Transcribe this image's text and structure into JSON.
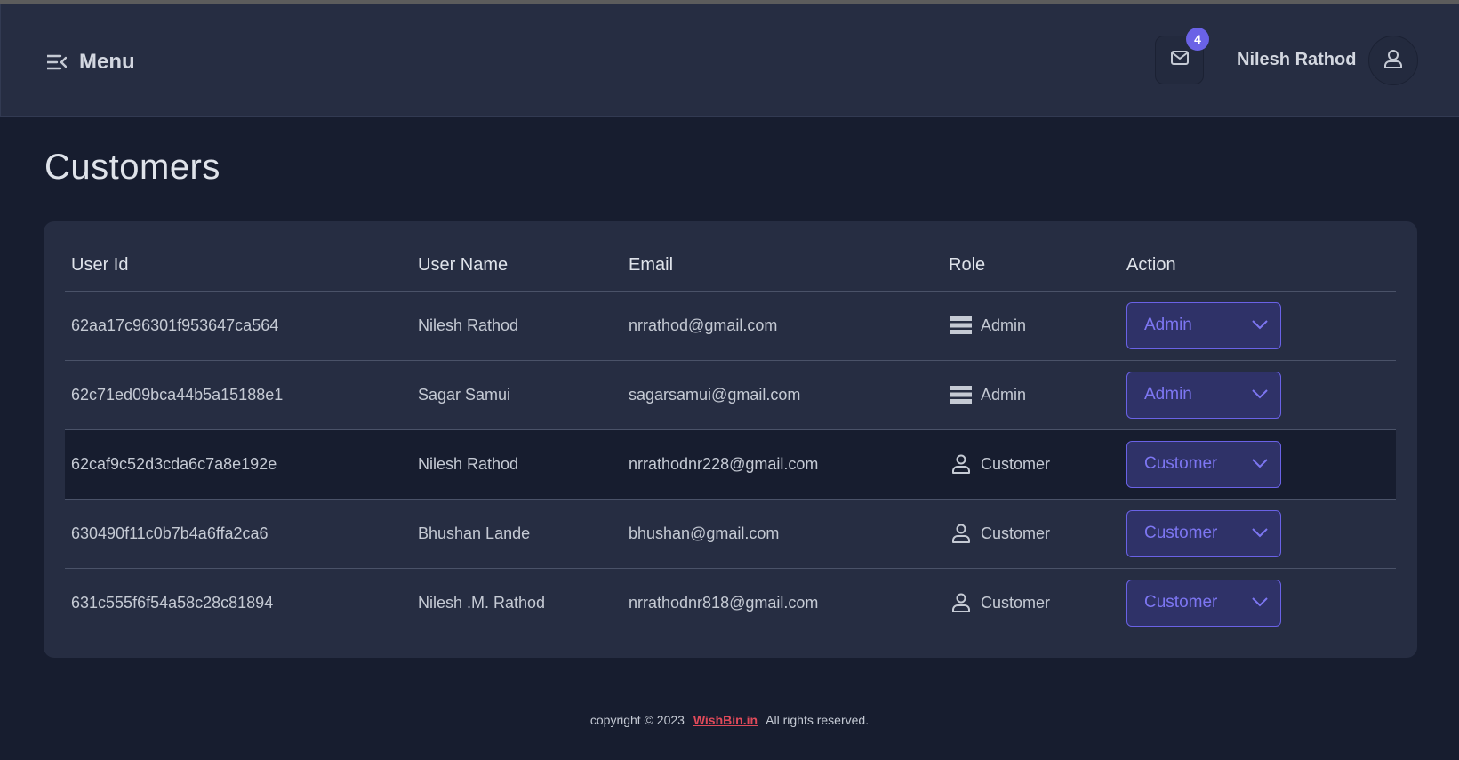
{
  "header": {
    "menu_label": "Menu",
    "notification_count": "4",
    "user_name": "Nilesh Rathod",
    "icons": {
      "menu": "menu-collapse-icon",
      "mail": "envelope-icon",
      "user": "user-icon"
    }
  },
  "page": {
    "title": "Customers"
  },
  "table": {
    "columns": [
      "User Id",
      "User Name",
      "Email",
      "Role",
      "Action"
    ],
    "rows": [
      {
        "id": "62aa17c96301f953647ca564",
        "name": "Nilesh Rathod",
        "email": "nrrathod@gmail.com",
        "role": "Admin",
        "role_icon": "server-icon",
        "action": "Admin"
      },
      {
        "id": "62c71ed09bca44b5a15188e1",
        "name": "Sagar Samui",
        "email": "sagarsamui@gmail.com",
        "role": "Admin",
        "role_icon": "server-icon",
        "action": "Admin"
      },
      {
        "id": "62caf9c52d3cda6c7a8e192e",
        "name": "Nilesh Rathod",
        "email": "nrrathodnr228@gmail.com",
        "role": "Customer",
        "role_icon": "user-icon",
        "action": "Customer"
      },
      {
        "id": "630490f11c0b7b4a6ffa2ca6",
        "name": "Bhushan Lande",
        "email": "bhushan@gmail.com",
        "role": "Customer",
        "role_icon": "user-icon",
        "action": "Customer"
      },
      {
        "id": "631c555f6f54a58c28c81894",
        "name": "Nilesh .M. Rathod",
        "email": "nrrathodnr818@gmail.com",
        "role": "Customer",
        "role_icon": "user-icon",
        "action": "Customer"
      }
    ]
  },
  "footer": {
    "prefix": "copyright © 2023",
    "link": "WishBin.in",
    "suffix": "All rights reserved."
  },
  "colors": {
    "background": "#171d2f",
    "panel": "#262d42",
    "accent": "#6a62e6",
    "link": "#e04a5a"
  }
}
